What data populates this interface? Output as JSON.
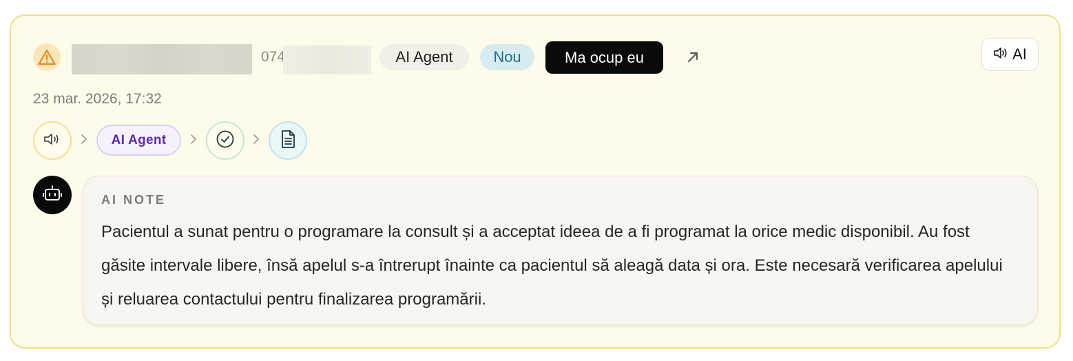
{
  "header": {
    "phone_prefix": "074",
    "source_badge": "AI Agent",
    "status_badge": "Nou",
    "take_button": "Ma ocup eu",
    "audio_button_label": "AI"
  },
  "timestamp": "23 mar. 2026, 17:32",
  "flow": {
    "steps": [
      "audio-icon",
      "AI Agent",
      "check-circle-icon",
      "document-icon"
    ],
    "agent_label": "AI Agent"
  },
  "note": {
    "label": "AI NOTE",
    "text": "Pacientul a sunat pentru o programare la consult și a acceptat ideea de a fi programat la orice medic disponibil. Au fost găsite intervale libere, însă apelul s-a întrerupt înainte ca pacientul să aleagă data și ora. Este necesară verificarea apelului și reluarea contactului pentru finalizarea programării."
  },
  "colors": {
    "card_background": "#fefbea",
    "card_border": "#f3de86",
    "warning": "#e8891c",
    "agent_purple": "#5b2aa8",
    "status_blue": "#1e6f96"
  }
}
